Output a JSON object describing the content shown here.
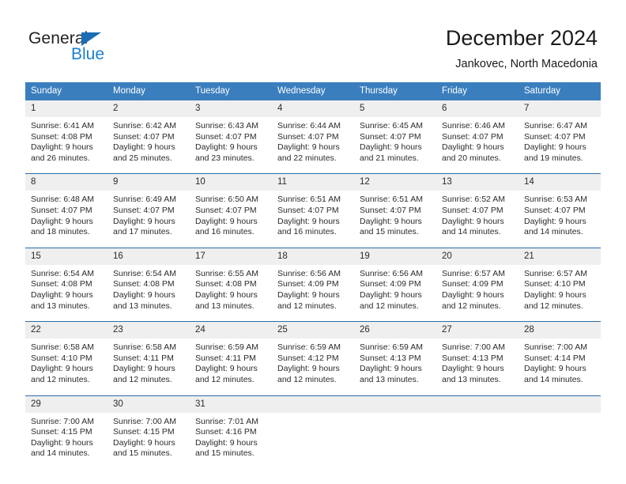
{
  "brand": {
    "name_part1": "General",
    "name_part2": "Blue",
    "logo_icon": "triangle-logo-icon"
  },
  "header": {
    "title": "December 2024",
    "subtitle": "Jankovec, North Macedonia"
  },
  "colors": {
    "header_blue": "#3a7ebe",
    "divider_blue": "#2d6ca8",
    "daynum_band": "#efefef",
    "brand_blue": "#1b7fd1",
    "text": "#2b2b2b"
  },
  "weekdays": [
    "Sunday",
    "Monday",
    "Tuesday",
    "Wednesday",
    "Thursday",
    "Friday",
    "Saturday"
  ],
  "labels": {
    "sunrise_prefix": "Sunrise:",
    "sunset_prefix": "Sunset:",
    "daylight_prefix": "Daylight:"
  },
  "weeks": [
    [
      {
        "day": "1",
        "line1": "Sunrise: 6:41 AM",
        "line2": "Sunset: 4:08 PM",
        "line3": "Daylight: 9 hours",
        "line4": "and 26 minutes."
      },
      {
        "day": "2",
        "line1": "Sunrise: 6:42 AM",
        "line2": "Sunset: 4:07 PM",
        "line3": "Daylight: 9 hours",
        "line4": "and 25 minutes."
      },
      {
        "day": "3",
        "line1": "Sunrise: 6:43 AM",
        "line2": "Sunset: 4:07 PM",
        "line3": "Daylight: 9 hours",
        "line4": "and 23 minutes."
      },
      {
        "day": "4",
        "line1": "Sunrise: 6:44 AM",
        "line2": "Sunset: 4:07 PM",
        "line3": "Daylight: 9 hours",
        "line4": "and 22 minutes."
      },
      {
        "day": "5",
        "line1": "Sunrise: 6:45 AM",
        "line2": "Sunset: 4:07 PM",
        "line3": "Daylight: 9 hours",
        "line4": "and 21 minutes."
      },
      {
        "day": "6",
        "line1": "Sunrise: 6:46 AM",
        "line2": "Sunset: 4:07 PM",
        "line3": "Daylight: 9 hours",
        "line4": "and 20 minutes."
      },
      {
        "day": "7",
        "line1": "Sunrise: 6:47 AM",
        "line2": "Sunset: 4:07 PM",
        "line3": "Daylight: 9 hours",
        "line4": "and 19 minutes."
      }
    ],
    [
      {
        "day": "8",
        "line1": "Sunrise: 6:48 AM",
        "line2": "Sunset: 4:07 PM",
        "line3": "Daylight: 9 hours",
        "line4": "and 18 minutes."
      },
      {
        "day": "9",
        "line1": "Sunrise: 6:49 AM",
        "line2": "Sunset: 4:07 PM",
        "line3": "Daylight: 9 hours",
        "line4": "and 17 minutes."
      },
      {
        "day": "10",
        "line1": "Sunrise: 6:50 AM",
        "line2": "Sunset: 4:07 PM",
        "line3": "Daylight: 9 hours",
        "line4": "and 16 minutes."
      },
      {
        "day": "11",
        "line1": "Sunrise: 6:51 AM",
        "line2": "Sunset: 4:07 PM",
        "line3": "Daylight: 9 hours",
        "line4": "and 16 minutes."
      },
      {
        "day": "12",
        "line1": "Sunrise: 6:51 AM",
        "line2": "Sunset: 4:07 PM",
        "line3": "Daylight: 9 hours",
        "line4": "and 15 minutes."
      },
      {
        "day": "13",
        "line1": "Sunrise: 6:52 AM",
        "line2": "Sunset: 4:07 PM",
        "line3": "Daylight: 9 hours",
        "line4": "and 14 minutes."
      },
      {
        "day": "14",
        "line1": "Sunrise: 6:53 AM",
        "line2": "Sunset: 4:07 PM",
        "line3": "Daylight: 9 hours",
        "line4": "and 14 minutes."
      }
    ],
    [
      {
        "day": "15",
        "line1": "Sunrise: 6:54 AM",
        "line2": "Sunset: 4:08 PM",
        "line3": "Daylight: 9 hours",
        "line4": "and 13 minutes."
      },
      {
        "day": "16",
        "line1": "Sunrise: 6:54 AM",
        "line2": "Sunset: 4:08 PM",
        "line3": "Daylight: 9 hours",
        "line4": "and 13 minutes."
      },
      {
        "day": "17",
        "line1": "Sunrise: 6:55 AM",
        "line2": "Sunset: 4:08 PM",
        "line3": "Daylight: 9 hours",
        "line4": "and 13 minutes."
      },
      {
        "day": "18",
        "line1": "Sunrise: 6:56 AM",
        "line2": "Sunset: 4:09 PM",
        "line3": "Daylight: 9 hours",
        "line4": "and 12 minutes."
      },
      {
        "day": "19",
        "line1": "Sunrise: 6:56 AM",
        "line2": "Sunset: 4:09 PM",
        "line3": "Daylight: 9 hours",
        "line4": "and 12 minutes."
      },
      {
        "day": "20",
        "line1": "Sunrise: 6:57 AM",
        "line2": "Sunset: 4:09 PM",
        "line3": "Daylight: 9 hours",
        "line4": "and 12 minutes."
      },
      {
        "day": "21",
        "line1": "Sunrise: 6:57 AM",
        "line2": "Sunset: 4:10 PM",
        "line3": "Daylight: 9 hours",
        "line4": "and 12 minutes."
      }
    ],
    [
      {
        "day": "22",
        "line1": "Sunrise: 6:58 AM",
        "line2": "Sunset: 4:10 PM",
        "line3": "Daylight: 9 hours",
        "line4": "and 12 minutes."
      },
      {
        "day": "23",
        "line1": "Sunrise: 6:58 AM",
        "line2": "Sunset: 4:11 PM",
        "line3": "Daylight: 9 hours",
        "line4": "and 12 minutes."
      },
      {
        "day": "24",
        "line1": "Sunrise: 6:59 AM",
        "line2": "Sunset: 4:11 PM",
        "line3": "Daylight: 9 hours",
        "line4": "and 12 minutes."
      },
      {
        "day": "25",
        "line1": "Sunrise: 6:59 AM",
        "line2": "Sunset: 4:12 PM",
        "line3": "Daylight: 9 hours",
        "line4": "and 12 minutes."
      },
      {
        "day": "26",
        "line1": "Sunrise: 6:59 AM",
        "line2": "Sunset: 4:13 PM",
        "line3": "Daylight: 9 hours",
        "line4": "and 13 minutes."
      },
      {
        "day": "27",
        "line1": "Sunrise: 7:00 AM",
        "line2": "Sunset: 4:13 PM",
        "line3": "Daylight: 9 hours",
        "line4": "and 13 minutes."
      },
      {
        "day": "28",
        "line1": "Sunrise: 7:00 AM",
        "line2": "Sunset: 4:14 PM",
        "line3": "Daylight: 9 hours",
        "line4": "and 14 minutes."
      }
    ],
    [
      {
        "day": "29",
        "line1": "Sunrise: 7:00 AM",
        "line2": "Sunset: 4:15 PM",
        "line3": "Daylight: 9 hours",
        "line4": "and 14 minutes."
      },
      {
        "day": "30",
        "line1": "Sunrise: 7:00 AM",
        "line2": "Sunset: 4:15 PM",
        "line3": "Daylight: 9 hours",
        "line4": "and 15 minutes."
      },
      {
        "day": "31",
        "line1": "Sunrise: 7:01 AM",
        "line2": "Sunset: 4:16 PM",
        "line3": "Daylight: 9 hours",
        "line4": "and 15 minutes."
      },
      {
        "day": "",
        "line1": "",
        "line2": "",
        "line3": "",
        "line4": ""
      },
      {
        "day": "",
        "line1": "",
        "line2": "",
        "line3": "",
        "line4": ""
      },
      {
        "day": "",
        "line1": "",
        "line2": "",
        "line3": "",
        "line4": ""
      },
      {
        "day": "",
        "line1": "",
        "line2": "",
        "line3": "",
        "line4": ""
      }
    ]
  ]
}
